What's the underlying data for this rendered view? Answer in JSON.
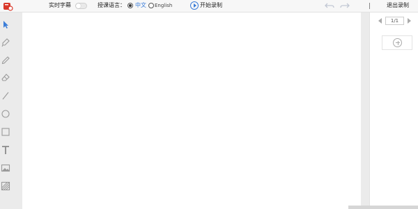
{
  "toolbar": {
    "live_caption_label": "实时字幕",
    "language_label": "授课语言：",
    "lang_options": [
      {
        "label": "中文",
        "selected": true
      },
      {
        "label": "English",
        "selected": false
      }
    ],
    "start_record_label": "开始录制",
    "exit_record_label": "退出录制"
  },
  "left_tools": [
    "pointer-icon",
    "highlighter-icon",
    "pencil-icon",
    "eraser-icon",
    "line-icon",
    "circle-icon",
    "rectangle-icon",
    "text-icon",
    "image-icon",
    "fill-icon"
  ],
  "right_panel": {
    "page_indicator": "1/1"
  },
  "colors": {
    "accent": "#3b7dd8",
    "logo_red": "#d9382a",
    "canvas": "#ffffff",
    "background": "#ebebeb"
  }
}
